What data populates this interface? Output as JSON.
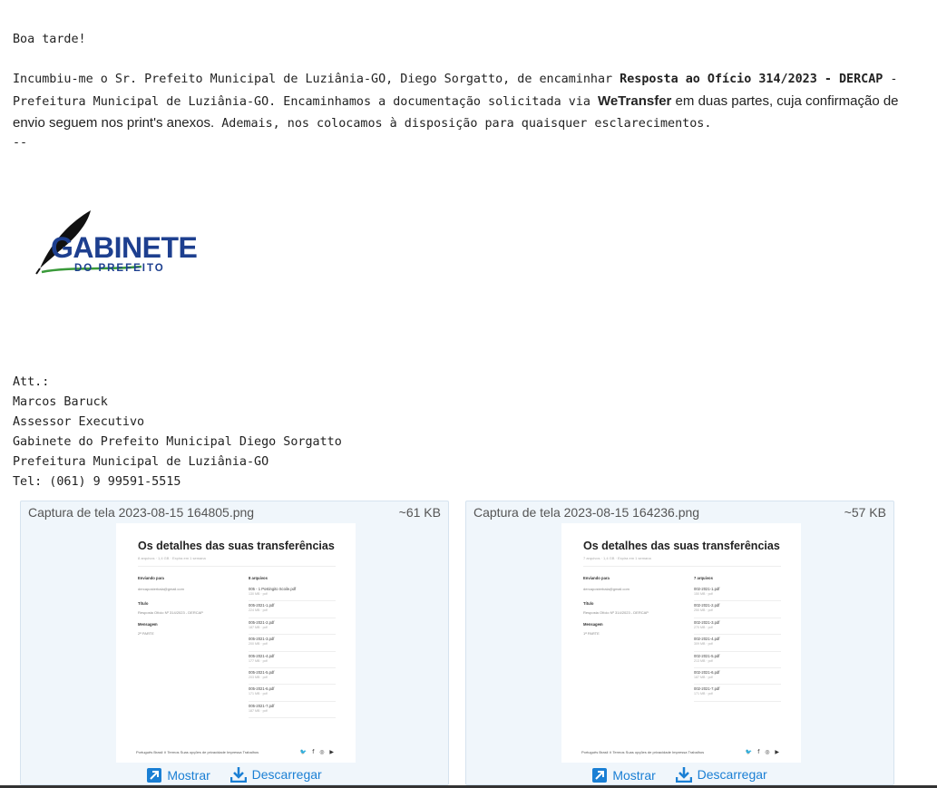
{
  "email": {
    "greeting": "Boa tarde!",
    "p1_a": "Incumbiu-me o Sr. Prefeito Municipal de Luziânia-GO, Diego Sorgatto, de encaminhar ",
    "p1_b": "Resposta ao Ofício 314/2023 - DERCAP",
    "p1_c": " -",
    "p2_a": "Prefeitura Municipal de Luziânia-GO. Encaminhamos a documentação solicitada via ",
    "p2_b": "WeTransfer",
    "p2_c": " em duas partes, cuja confirmação de",
    "p3_a": "envio seguem nos print's anexos.",
    "p3_b": " Ademais, nos colocamos à disposição para quaisquer esclarecimentos.",
    "sep": "--"
  },
  "logo": {
    "main": "GABINETE",
    "sub": "DO PREFEITO"
  },
  "signature": [
    "Att.:",
    "Marcos Baruck",
    "Assessor Executivo",
    "Gabinete do Prefeito Municipal Diego Sorgatto",
    "Prefeitura Municipal de Luziânia-GO",
    "Tel: (061) 9 99591-5515"
  ],
  "attachments": [
    {
      "filename": "Captura de tela 2023-08-15 164805.png",
      "size": "~61 KB",
      "thumb": {
        "title": "Os detalhes das suas transferências",
        "subtitle": "8 arquivos · 1,4 GB · Expira em 1 semana",
        "sent_to_label": "Enviando para",
        "sent_to": "dercaposterbala@gmail.com",
        "title_label": "Título",
        "title_value": "Resposta Ofício Nº 314/2023 - DERCAP",
        "message_label": "Mensagem",
        "message_value": "2ª PARTE",
        "files_label": "8 arquivos",
        "files": [
          {
            "n": "005 - 1 Postingito Scoile.pdf",
            "s": "130 MB · pdf"
          },
          {
            "n": "005-2021-1.pdf",
            "s": "224 MB · pdf"
          },
          {
            "n": "005-2021-2.pdf",
            "s": "187 MB · pdf"
          },
          {
            "n": "005-2021-3.pdf",
            "s": "200 MB · pdf"
          },
          {
            "n": "005-2021-4.pdf",
            "s": "177 MB · pdf"
          },
          {
            "n": "005-2021-5.pdf",
            "s": "203 MB · pdf"
          },
          {
            "n": "005-2021-6.pdf",
            "s": "171 MB · pdf"
          },
          {
            "n": "005-2021-7.pdf",
            "s": "187 MB · pdf"
          }
        ],
        "footer": "Português Brasil ∨   Termos   Suas opções de privacidade   Impressa   Trabalhos",
        "social": "🐦 f ◎ ▶"
      },
      "show": "Mostrar",
      "download": "Descarregar"
    },
    {
      "filename": "Captura de tela 2023-08-15 164236.png",
      "size": "~57 KB",
      "thumb": {
        "title": "Os detalhes das suas transferências",
        "subtitle": "7 arquivos · 1,4 GB · Expira em 1 semana",
        "sent_to_label": "Enviando para",
        "sent_to": "dercaposterbala@gmail.com",
        "title_label": "Título",
        "title_value": "Resposta Ofício Nº 314/2023 - DERCAP",
        "message_label": "Mensagem",
        "message_value": "1ª PARTE",
        "files_label": "7 arquivos",
        "files": [
          {
            "n": "002-2021-1.pdf",
            "s": "150 MB · pdf"
          },
          {
            "n": "002-2021-2.pdf",
            "s": "250 MB · pdf"
          },
          {
            "n": "002-2021-3.pdf",
            "s": "270 MB · pdf"
          },
          {
            "n": "002-2021-4.pdf",
            "s": "309 MB · pdf"
          },
          {
            "n": "002-2021-5.pdf",
            "s": "213 MB · pdf"
          },
          {
            "n": "002-2021-6.pdf",
            "s": "187 MB · pdf"
          },
          {
            "n": "002-2021-7.pdf",
            "s": "171 MB · pdf"
          }
        ],
        "footer": "Português Brasil ∨   Termos   Suas opções de privacidade   Impressa   Trabalhos",
        "social": "🐦 f ◎ ▶"
      },
      "show": "Mostrar",
      "download": "Descarregar"
    }
  ],
  "colors": {
    "link": "#1a7fd4",
    "logo_blue": "#1d3f8f",
    "logo_green": "#3a9a3a",
    "card_bg": "#f0f6fb"
  }
}
